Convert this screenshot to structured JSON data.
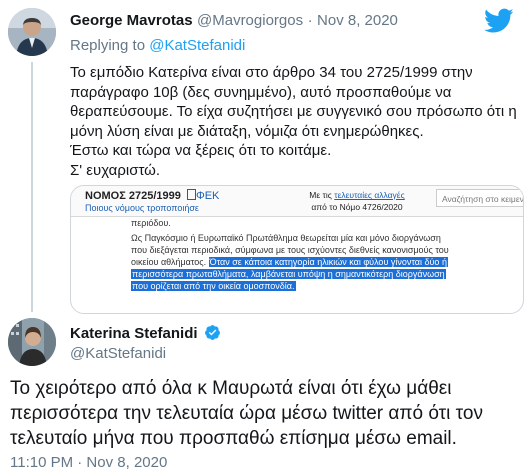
{
  "reply_tweet": {
    "author_name": "George Mavrotas",
    "author_handle": "@Mavrogiorgos",
    "separator": "·",
    "date": "Nov 8, 2020",
    "replying_to_prefix": "Replying to ",
    "replying_to_handle": "@KatStefanidi",
    "lines": [
      "Το εμπόδιο Κατερίνα είναι στο άρθρο 34 του 2725/1999 στην",
      "παράγραφο 10β (δες συνημμένο), αυτό προσπαθούμε να",
      "θεραπεύσουμε. Το είχα συζητήσει με συγγενικό σου πρόσωπο ότι η",
      "μόνη λύση είναι με διάταξη, νόμιζα ότι ενημερώθηκες.",
      "Έστω και τώρα να ξέρεις ότι το κοιτάμε.",
      "Σ' ευχαριστώ."
    ]
  },
  "attachment": {
    "law_title": "ΝΟΜΟΣ 2725/1999",
    "fek_label": "ΦΕΚ",
    "modifying_laws": "Ποιους νόμους τροποποιήσε",
    "changes_prefix": "Με τις ",
    "changes_link": "τελευταίες αλλαγές",
    "changes_suffix": "από το Νόμο 4726/2020",
    "search_placeholder": "Αναζήτηση στο κειμενο",
    "fragment_top": "περιόδου.",
    "para_line1": "Ως Παγκόσμιο ή Ευρωπαϊκό Πρωτάθλημα θεωρείται μία και μόνο διοργάνωση",
    "para_line2": "που  διεξάγεται περιοδικά, σύμφωνα με τους ισχύοντες διεθνείς κανονισμούς του",
    "para_line3_plain": "οικείου αθλήματος. ",
    "para_line3_hl": "Όταν σε κάποια κατηγορία ηλικιών και φύλου γίνονται δύο ή",
    "para_line4_hl": "περισσότερα πρωταθλήματα, λαμβάνεται υπόψη η σημαντικότερη διοργάνωση",
    "para_line5_hl": "που  ορίζεται από την οικεία ομοσπονδία."
  },
  "main_tweet": {
    "author_name": "Katerina Stefanidi",
    "author_handle": "@KatStefanidi",
    "verified_icon": "verified-badge-icon",
    "lines": [
      "Το χειρότερο από όλα κ Μαυρωτά είναι ότι έχω μάθει",
      "περισσότερα την τελευταία ώρα μέσω twitter από ότι τον",
      "τελευταίο μήνα που προσπαθώ επίσημα μέσω email."
    ],
    "timestamp": "11:10 PM · Nov 8, 2020"
  },
  "brand": {
    "logo_icon": "twitter-bird-icon",
    "color": "#1da1f2"
  },
  "colors": {
    "text": "#14171a",
    "muted": "#657786",
    "link": "#1da1f2",
    "highlight": "#1c6fd6"
  }
}
